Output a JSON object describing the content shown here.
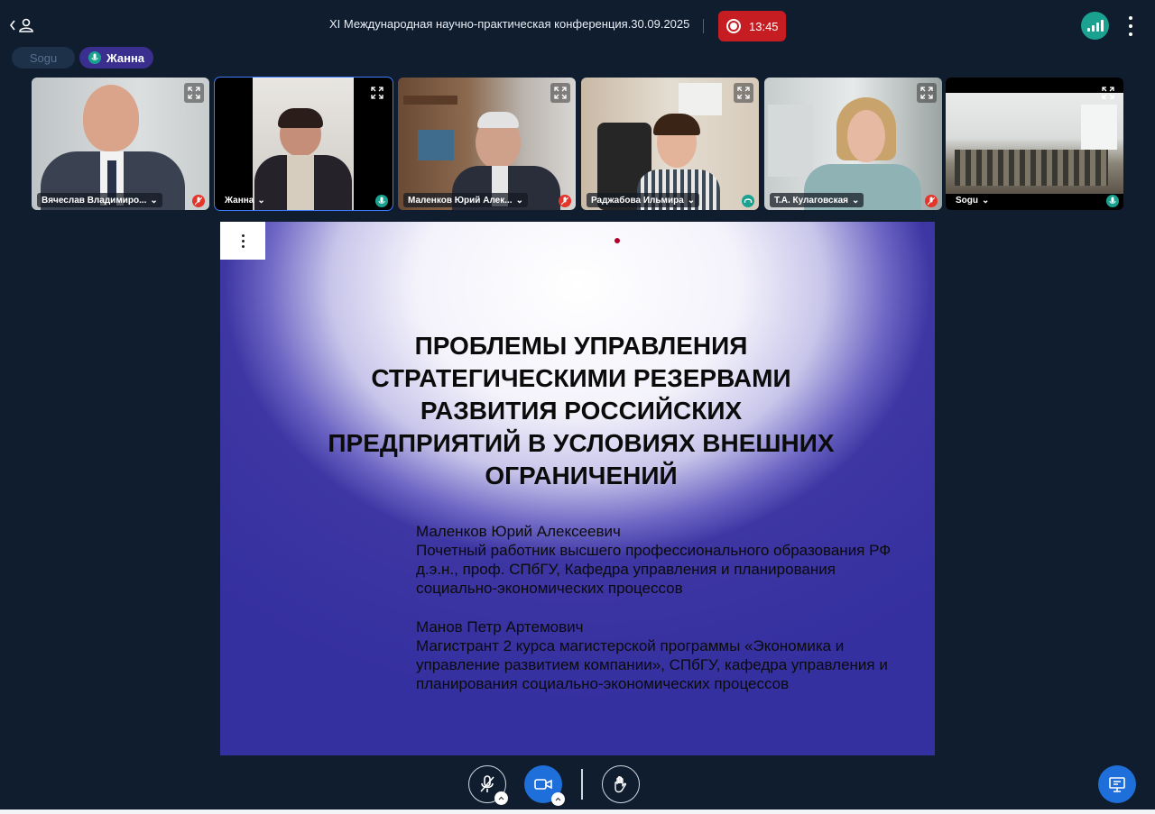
{
  "header": {
    "title": "XI Международная научно-практическая конференция.30.09.2025",
    "recording_time": "13:45",
    "colors": {
      "record": "#c51d22",
      "signal": "#1aa190",
      "accent": "#1e6fd9"
    }
  },
  "speakers": [
    {
      "label": "Sogu",
      "speaking": false
    },
    {
      "label": "Жанна",
      "speaking": true
    }
  ],
  "participants": [
    {
      "name": "Вячеслав Владимиро...",
      "status": "muted",
      "active": false
    },
    {
      "name": "Жанна",
      "status": "speaking",
      "active": true
    },
    {
      "name": "Маленков Юрий Алек...",
      "status": "muted",
      "active": false
    },
    {
      "name": "Раджабова Ильмира",
      "status": "headset",
      "active": false
    },
    {
      "name": "Т.А. Кулаговская",
      "status": "muted",
      "active": false
    },
    {
      "name": "Sogu",
      "status": "speaking",
      "active": false
    }
  ],
  "slide": {
    "title": "ПРОБЛЕМЫ УПРАВЛЕНИЯ\nСТРАТЕГИЧЕСКИМИ РЕЗЕРВАМИ\nРАЗВИТИЯ РОССИЙСКИХ\nПРЕДПРИЯТИЙ В УСЛОВИЯХ ВНЕШНИХ\nОГРАНИЧЕНИЙ",
    "authors": [
      {
        "name": "Маленков Юрий Алексеевич",
        "lines": [
          "Почетный работник высшего профессионального образования РФ",
          "д.э.н., проф. СПбГУ, Кафедра управления и планирования",
          "социально-экономических процессов"
        ]
      },
      {
        "name": "Манов Петр Артемович",
        "lines": [
          "Магистрант 2 курса магистерской программы «Экономика и",
          "управление развитием компании», СПбГУ, кафедра управления и",
          "планирования социально-экономических процессов"
        ]
      }
    ]
  },
  "icons": {
    "participants": "participants-icon",
    "signal": "signal-strength-icon",
    "more": "more-vertical-icon",
    "expand": "expand-icon",
    "mic_off": "mic-off-icon",
    "camera": "camera-icon",
    "hand": "raise-hand-icon",
    "present": "present-screen-icon"
  }
}
